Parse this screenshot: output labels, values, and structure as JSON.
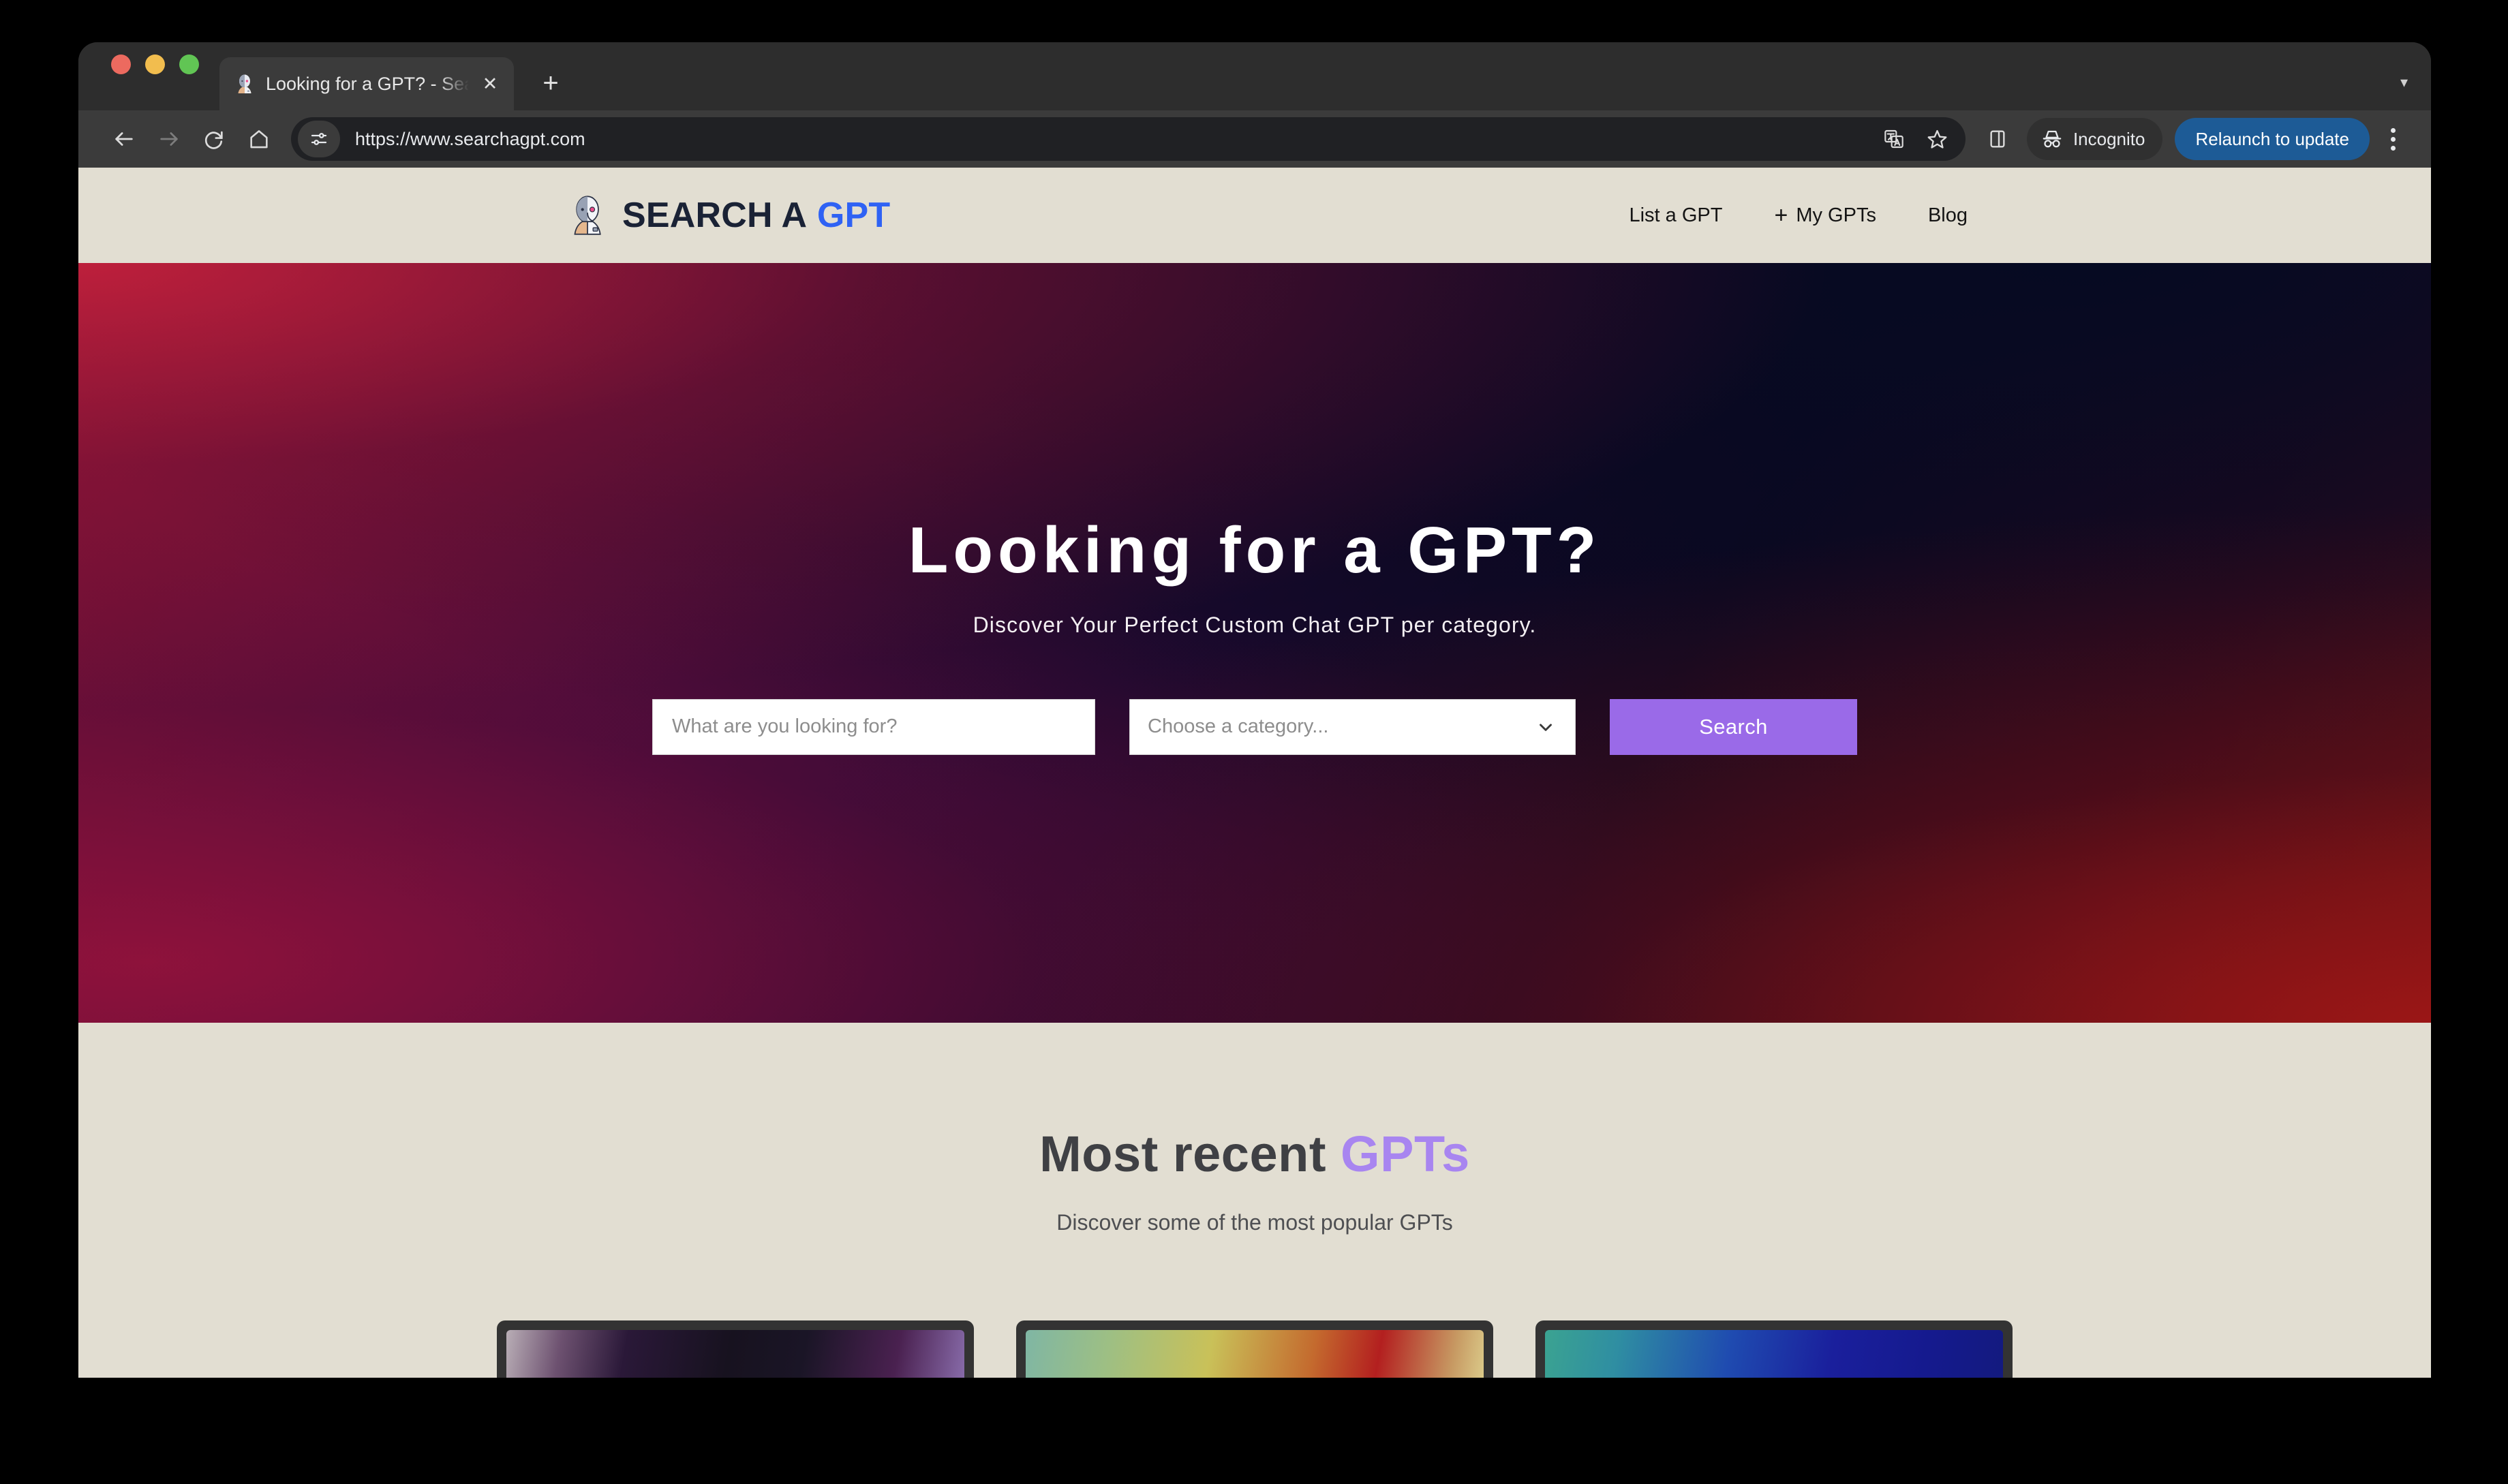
{
  "browser": {
    "tab": {
      "title": "Looking for a GPT? - Search a GPT",
      "favicon_icon": "cyborg-head-icon",
      "close_icon": "close-icon"
    },
    "new_tab_icon": "plus-icon",
    "tab_list_chevron_icon": "chevron-down-icon",
    "toolbar": {
      "back_icon": "back-arrow-icon",
      "forward_icon": "forward-arrow-icon",
      "reload_icon": "reload-icon",
      "home_icon": "home-icon",
      "site_info_icon": "site-settings-icon",
      "url": "https://www.searchagpt.com",
      "translate_icon": "translate-icon",
      "bookmark_icon": "star-icon",
      "side_panel_icon": "side-panel-icon",
      "incognito_icon": "incognito-hat-icon",
      "incognito_label": "Incognito",
      "relaunch_label": "Relaunch to update",
      "relaunch_color": "#1d5b96",
      "menu_icon": "kebab-menu-icon"
    }
  },
  "site": {
    "header": {
      "logo_icon": "cyborg-head-icon",
      "brand_primary": "SEARCH A",
      "brand_accent": "GPT",
      "brand_accent_color": "#2f62f4",
      "nav": [
        {
          "label": "List a GPT",
          "icon": null
        },
        {
          "label": "My GPTs",
          "icon": "plus-icon"
        },
        {
          "label": "Blog",
          "icon": null
        }
      ]
    },
    "hero": {
      "title": "Looking for a GPT?",
      "subtitle": "Discover Your Perfect Custom Chat GPT per category.",
      "search_placeholder": "What are you looking for?",
      "search_value": "",
      "category_placeholder": "Choose a category...",
      "category_value": "",
      "category_chevron_icon": "chevron-down-icon",
      "search_button_label": "Search",
      "search_button_color": "#9a6ae8"
    },
    "recent": {
      "title_primary": "Most recent",
      "title_accent": "GPTs",
      "title_accent_color": "#a885f0",
      "subtitle": "Discover some of the most popular GPTs",
      "cards": [
        {
          "thumbnail": "purple-dark-gradient"
        },
        {
          "thumbnail": "green-yellow-red-gradient"
        },
        {
          "thumbnail": "teal-blue-gradient"
        }
      ]
    }
  }
}
